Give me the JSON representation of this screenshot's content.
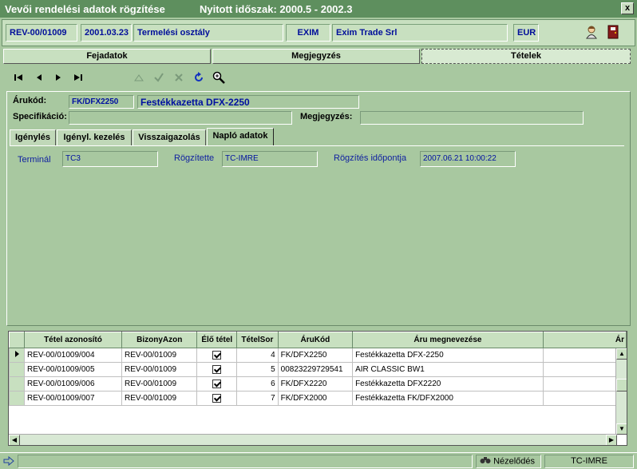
{
  "window": {
    "title": "Vevői rendelési adatok rögzítése",
    "period": "Nyitott időszak: 2000.5 - 2002.3",
    "close": "x"
  },
  "header": {
    "doc_id": "REV-00/01009",
    "date": "2001.03.23",
    "department": "Termelési osztály",
    "partner_code": "EXIM",
    "partner_name": "Exim Trade Srl",
    "currency": "EUR"
  },
  "tabs": [
    "Fejadatok",
    "Megjegyzés",
    "Tételek"
  ],
  "detail": {
    "item_code_label": "Árukód:",
    "item_code": "FK/DFX2250",
    "item_name": "Festékkazetta DFX-2250",
    "spec_label": "Specifikáció:",
    "spec_value": "",
    "note_label": "Megjegyzés:",
    "note_value": ""
  },
  "subtabs": [
    "Igénylés",
    "Igényl. kezelés",
    "Visszaigazolás",
    "Napló adatok"
  ],
  "log": {
    "terminal_label": "Terminál",
    "terminal": "TC3",
    "recorded_by_label": "Rögzítette",
    "recorded_by": "TC-IMRE",
    "recorded_at_label": "Rögzítés időpontja",
    "recorded_at": "2007.06.21 10:00:22"
  },
  "grid": {
    "columns": [
      "Tétel azonosító",
      "BizonyAzon",
      "Élő tétel",
      "TételSor",
      "ÁruKód",
      "Áru megnevezése",
      "Ár"
    ],
    "rows": [
      [
        "REV-00/01009/004",
        "REV-00/01009",
        true,
        "4",
        "FK/DFX2250",
        "Festékkazetta DFX-2250"
      ],
      [
        "REV-00/01009/005",
        "REV-00/01009",
        true,
        "5",
        "00823229729541",
        "AIR CLASSIC BW1"
      ],
      [
        "REV-00/01009/006",
        "REV-00/01009",
        true,
        "6",
        "FK/DFX2220",
        "Festékkazetta DFX2220"
      ],
      [
        "REV-00/01009/007",
        "REV-00/01009",
        true,
        "7",
        "FK/DFX2000",
        "Festékkazetta FK/DFX2000"
      ]
    ]
  },
  "status": {
    "mode": "Nézelődés",
    "user": "TC-IMRE"
  },
  "colors": {
    "background": "#a8c8a0",
    "title_bar": "#5e8f5e",
    "field_text": "#0010a0"
  }
}
